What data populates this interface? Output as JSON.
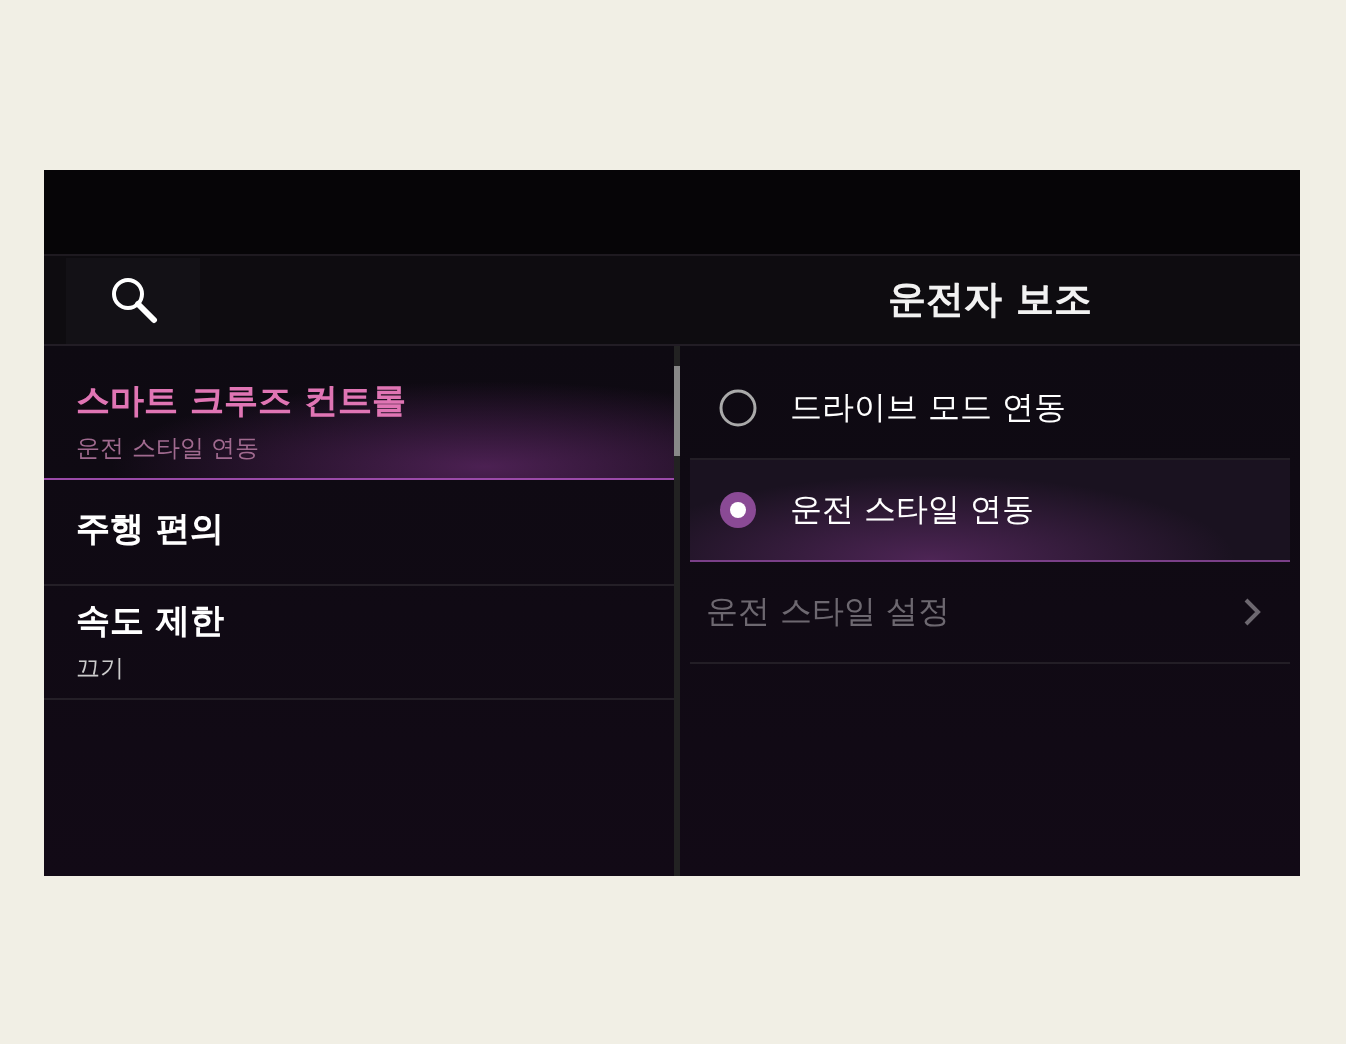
{
  "header": {
    "title": "운전자 보조"
  },
  "menu": [
    {
      "label": "스마트 크루즈 컨트롤",
      "subtitle": "운전 스타일 연동",
      "selected": true
    },
    {
      "label": "주행 편의",
      "selected": false
    },
    {
      "label": "속도 제한",
      "subtitle": "끄기",
      "selected": false
    }
  ],
  "options": [
    {
      "kind": "radio",
      "label": "드라이브 모드 연동",
      "selected": false
    },
    {
      "kind": "radio",
      "label": "운전 스타일 연동",
      "selected": true
    },
    {
      "kind": "link",
      "label": "운전 스타일 설정",
      "disabled": true
    }
  ]
}
